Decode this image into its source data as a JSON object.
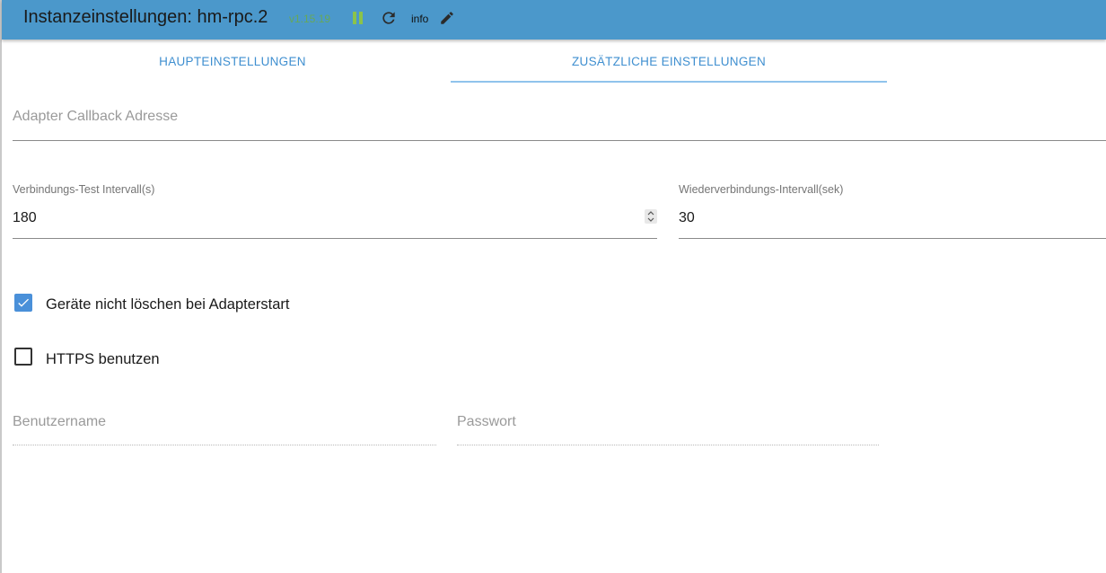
{
  "header": {
    "title": "Instanzeinstellungen: hm-rpc.2",
    "version": "v1.15.19",
    "info_label": "info",
    "colors": {
      "bar": "#4b98cb",
      "version": "#66a85a",
      "pause": "#8bc34a"
    }
  },
  "tabs": [
    {
      "label": "HAUPTEINSTELLUNGEN",
      "active": false
    },
    {
      "label": "ZUSÄTZLICHE EINSTELLUNGEN",
      "active": true
    }
  ],
  "fields": {
    "callback_address": {
      "label": "Adapter Callback Adresse",
      "value": ""
    },
    "test_interval": {
      "label": "Verbindungs-Test Intervall(s)",
      "value": "180"
    },
    "reconnect_interval": {
      "label": "Wiederverbindungs-Intervall(sek)",
      "value": "30"
    },
    "username": {
      "label": "Benutzername",
      "value": ""
    },
    "password": {
      "label": "Passwort",
      "value": ""
    }
  },
  "checkboxes": {
    "keep_devices": {
      "label": "Geräte nicht löschen bei Adapterstart",
      "checked": true
    },
    "use_https": {
      "label": "HTTPS benutzen",
      "checked": false
    }
  },
  "icons": {
    "pause": "pause-icon",
    "reload": "reload-icon",
    "edit": "edit-pencil-icon",
    "check": "check-icon",
    "spinner": "spinner-arrows-icon"
  }
}
